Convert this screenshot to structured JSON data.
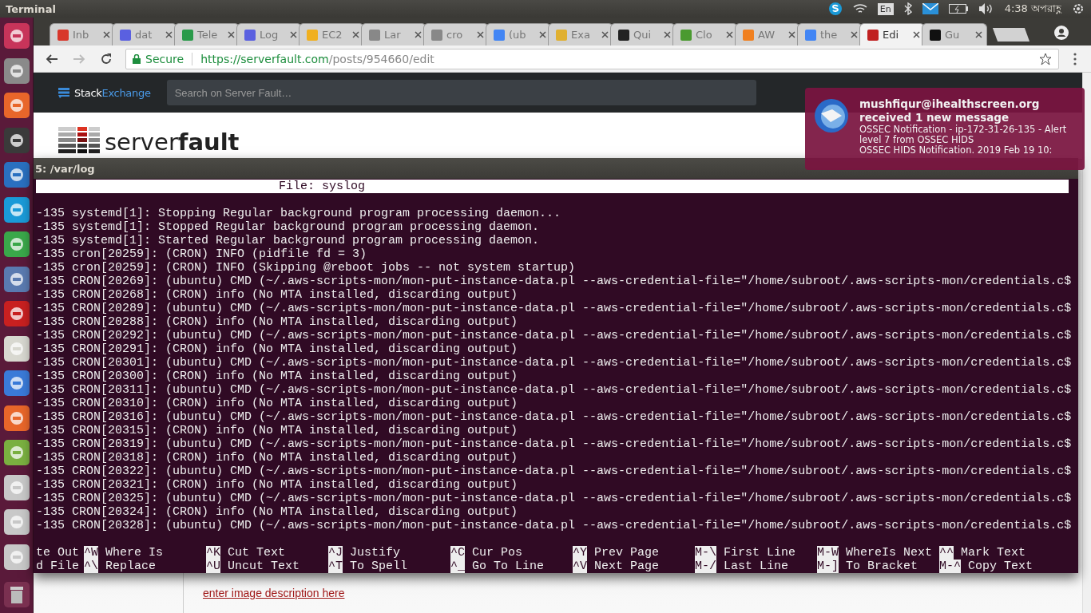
{
  "panel": {
    "title": "Terminal",
    "keyboard": "En",
    "time": "4:38 অপরাহ্ণ"
  },
  "browser": {
    "tabs": [
      {
        "label": "Inb",
        "selected": false
      },
      {
        "label": "dat",
        "selected": false
      },
      {
        "label": "Tele",
        "selected": false
      },
      {
        "label": "Log",
        "selected": false
      },
      {
        "label": "EC2",
        "selected": false
      },
      {
        "label": "Lar",
        "selected": false
      },
      {
        "label": "cro",
        "selected": false
      },
      {
        "label": "(ub",
        "selected": false
      },
      {
        "label": "Exa",
        "selected": false
      },
      {
        "label": "Qui",
        "selected": false
      },
      {
        "label": "Clo",
        "selected": false
      },
      {
        "label": "AW",
        "selected": false
      },
      {
        "label": "the",
        "selected": false
      },
      {
        "label": "Edi",
        "selected": true
      },
      {
        "label": "Gu",
        "selected": false
      }
    ],
    "secure_label": "Secure",
    "url_host": "https://serverfault.com",
    "url_path": "/posts/954660/edit"
  },
  "page": {
    "brand_first": "Stack",
    "brand_second": "Exchange",
    "search": {
      "placeholder": "Search on Server Fault…"
    },
    "logo": "server**fault**",
    "link": "enter image description here"
  },
  "terminal": {
    "title": "5: /var/log",
    "header": "File: syslog",
    "lines": [
      "-135 systemd[1]: Stopping Regular background program processing daemon...",
      "-135 systemd[1]: Stopped Regular background program processing daemon.",
      "-135 systemd[1]: Started Regular background program processing daemon.",
      "-135 cron[20259]: (CRON) INFO (pidfile fd = 3)",
      "-135 cron[20259]: (CRON) INFO (Skipping @reboot jobs -- not system startup)",
      "-135 CRON[20269]: (ubuntu) CMD (~/.aws-scripts-mon/mon-put-instance-data.pl --aws-credential-file=\"/home/subroot/.aws-scripts-mon/credentials.c$",
      "-135 CRON[20268]: (CRON) info (No MTA installed, discarding output)",
      "-135 CRON[20289]: (ubuntu) CMD (~/.aws-scripts-mon/mon-put-instance-data.pl --aws-credential-file=\"/home/subroot/.aws-scripts-mon/credentials.c$",
      "-135 CRON[20288]: (CRON) info (No MTA installed, discarding output)",
      "-135 CRON[20292]: (ubuntu) CMD (~/.aws-scripts-mon/mon-put-instance-data.pl --aws-credential-file=\"/home/subroot/.aws-scripts-mon/credentials.c$",
      "-135 CRON[20291]: (CRON) info (No MTA installed, discarding output)",
      "-135 CRON[20301]: (ubuntu) CMD (~/.aws-scripts-mon/mon-put-instance-data.pl --aws-credential-file=\"/home/subroot/.aws-scripts-mon/credentials.c$",
      "-135 CRON[20300]: (CRON) info (No MTA installed, discarding output)",
      "-135 CRON[20311]: (ubuntu) CMD (~/.aws-scripts-mon/mon-put-instance-data.pl --aws-credential-file=\"/home/subroot/.aws-scripts-mon/credentials.c$",
      "-135 CRON[20310]: (CRON) info (No MTA installed, discarding output)",
      "-135 CRON[20316]: (ubuntu) CMD (~/.aws-scripts-mon/mon-put-instance-data.pl --aws-credential-file=\"/home/subroot/.aws-scripts-mon/credentials.c$",
      "-135 CRON[20315]: (CRON) info (No MTA installed, discarding output)",
      "-135 CRON[20319]: (ubuntu) CMD (~/.aws-scripts-mon/mon-put-instance-data.pl --aws-credential-file=\"/home/subroot/.aws-scripts-mon/credentials.c$",
      "-135 CRON[20318]: (CRON) info (No MTA installed, discarding output)",
      "-135 CRON[20322]: (ubuntu) CMD (~/.aws-scripts-mon/mon-put-instance-data.pl --aws-credential-file=\"/home/subroot/.aws-scripts-mon/credentials.c$",
      "-135 CRON[20321]: (CRON) info (No MTA installed, discarding output)",
      "-135 CRON[20325]: (ubuntu) CMD (~/.aws-scripts-mon/mon-put-instance-data.pl --aws-credential-file=\"/home/subroot/.aws-scripts-mon/credentials.c$",
      "-135 CRON[20324]: (CRON) info (No MTA installed, discarding output)",
      "-135 CRON[20328]: (ubuntu) CMD (~/.aws-scripts-mon/mon-put-instance-data.pl --aws-credential-file=\"/home/subroot/.aws-scripts-mon/credentials.c$"
    ],
    "shortcuts": [
      [
        {
          "label": "te Out"
        },
        {
          "key": "^W",
          "label": "Where Is"
        },
        {
          "key": "^K",
          "label": "Cut Text"
        },
        {
          "key": "^J",
          "label": "Justify"
        },
        {
          "key": "^C",
          "label": "Cur Pos"
        },
        {
          "key": "^Y",
          "label": "Prev Page"
        },
        {
          "key": "M-\\",
          "label": "First Line"
        },
        {
          "key": "M-W",
          "label": "WhereIs Next"
        },
        {
          "key": "^^",
          "label": "Mark Text"
        }
      ],
      [
        {
          "label": "d File"
        },
        {
          "key": "^\\",
          "label": "Replace"
        },
        {
          "key": "^U",
          "label": "Uncut Text"
        },
        {
          "key": "^T",
          "label": "To Spell"
        },
        {
          "key": "^_",
          "label": "Go To Line"
        },
        {
          "key": "^V",
          "label": "Next Page"
        },
        {
          "key": "M-/",
          "label": "Last Line"
        },
        {
          "key": "M-]",
          "label": "To Bracket"
        },
        {
          "key": "M-^",
          "label": "Copy Text"
        }
      ]
    ]
  },
  "notification": {
    "title": [
      "mushfiqur@ihealthscreen.org",
      "received 1 new message"
    ],
    "body": [
      "OSSEC Notification - ip-172-31-26-135 - Alert",
      "level 7 from OSSEC HIDS",
      "OSSEC HIDS Notification. 2019 Feb 19 10:"
    ]
  }
}
